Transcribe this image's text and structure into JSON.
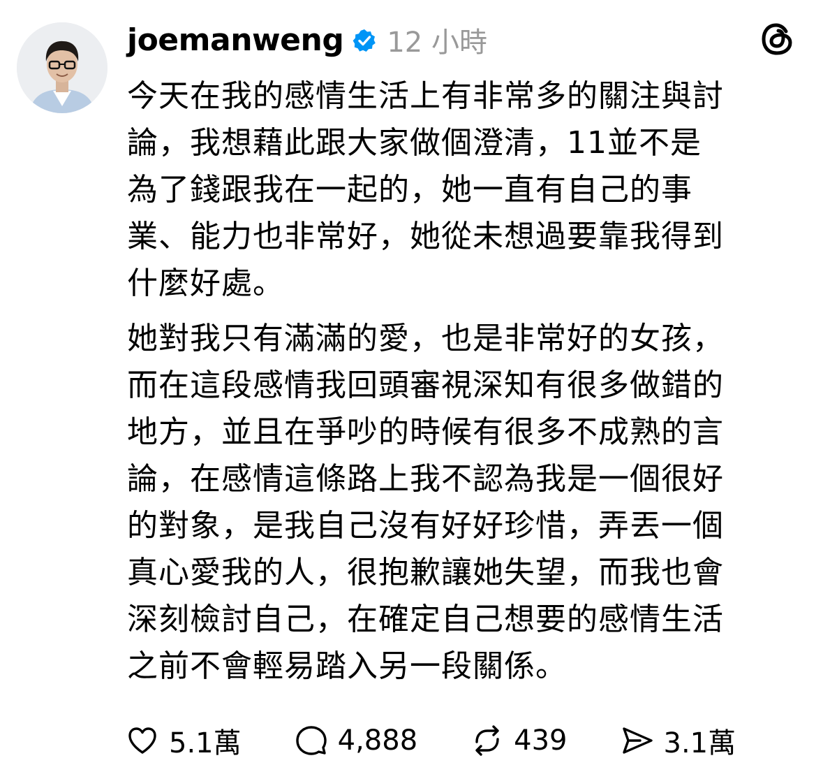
{
  "post": {
    "username": "joemanweng",
    "verified_icon": "verified-badge-icon",
    "time": "12 小時",
    "app_icon": "threads-logo-icon",
    "avatar_icon": "profile-avatar",
    "paragraphs": [
      "今天在我的感情生活上有非常多的關注與討\n論，我想藉此跟大家做個澄清，11並不是\n為了錢跟我在一起的，她一直有自己的事\n業、能力也非常好，她從未想過要靠我得到\n什麼好處。",
      "她對我只有滿滿的愛，也是非常好的女孩，\n而在這段感情我回頭審視深知有很多做錯的\n地方，並且在爭吵的時候有很多不成熟的言\n論，在感情這條路上我不認為我是一個很好\n的對象，是我自己沒有好好珍惜，弄丟一個\n真心愛我的人，很抱歉讓她失望，而我也會\n深刻檢討自己，在確定自己想要的感情生活\n之前不會輕易踏入另一段關係。"
    ],
    "actions": {
      "like": {
        "icon": "heart-icon",
        "count": "5.1萬"
      },
      "reply": {
        "icon": "comment-icon",
        "count": "4,888"
      },
      "repost": {
        "icon": "repost-icon",
        "count": "439"
      },
      "share": {
        "icon": "share-icon",
        "count": "3.1萬"
      }
    },
    "colors": {
      "text": "#000000",
      "muted": "#999999",
      "verified": "#0095f6"
    }
  }
}
